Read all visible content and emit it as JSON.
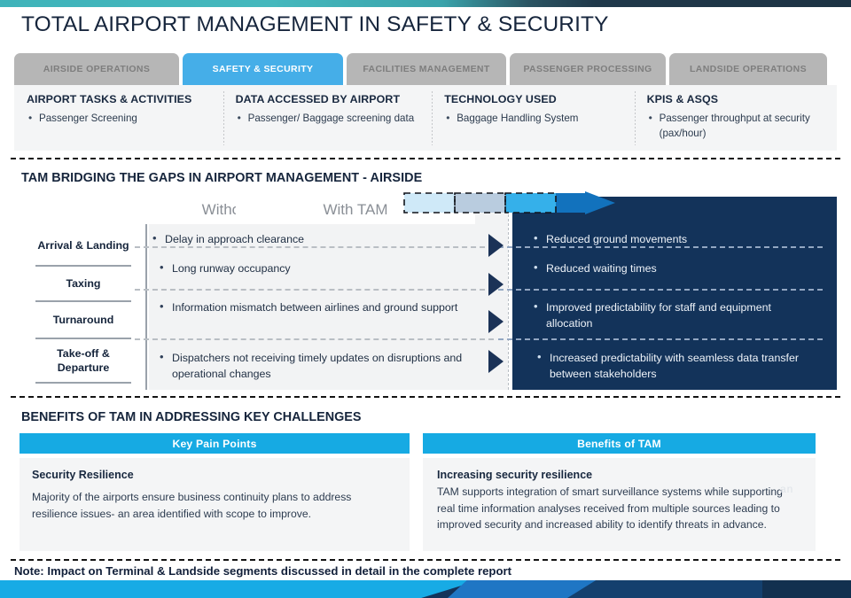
{
  "header": {
    "title": "TOTAL AIRPORT MANAGEMENT IN SAFETY & SECURITY",
    "accent_teal": "#3fb3ba",
    "accent_navy": "#1d3344"
  },
  "tabs": {
    "active_color": "#45aee8",
    "inactive_color": "#b6b6b6",
    "items": [
      {
        "label": "AIRSIDE OPERATIONS",
        "active": false
      },
      {
        "label": "SAFETY & SECURITY",
        "active": true
      },
      {
        "label": "FACILITIES MANAGEMENT",
        "active": false
      },
      {
        "label": "PASSENGER PROCESSING",
        "active": false
      },
      {
        "label": "LANDSIDE OPERATIONS",
        "active": false
      }
    ]
  },
  "info_strip": {
    "columns": [
      {
        "heading": "AIRPORT TASKS & ACTIVITIES",
        "items": [
          "Passenger Screening"
        ]
      },
      {
        "heading": "DATA ACCESSED BY AIRPORT",
        "items": [
          "Passenger/ Baggage screening data"
        ]
      },
      {
        "heading": "TECHNOLOGY USED",
        "items": [
          "Baggage Handling System"
        ]
      },
      {
        "heading": "KPIS & ASQS",
        "items": [
          "Passenger throughput at security (pax/hour)"
        ]
      }
    ]
  },
  "bridging": {
    "heading": "TAM BRIDGING THE GAPS IN AIRPORT MANAGEMENT - AIRSIDE",
    "without_label": "Without TAM",
    "with_label": "With TAM",
    "panel_color": "#13335a",
    "arrow_segments": [
      "#cfe9f8",
      "#b9ccdf",
      "#35b0ea",
      "#1272bd"
    ],
    "stages": [
      "Arrival & Landing",
      "Taxing",
      "Turnaround",
      "Take-off & Departure"
    ],
    "without_items": [
      "Delay in approach clearance",
      "Long runway occupancy",
      "Information mismatch between airlines and ground support",
      "Dispatchers not receiving timely updates on disruptions and operational changes"
    ],
    "with_items": [
      "Reduced ground movements",
      "Reduced waiting times",
      "Improved predictability for staff and equipment allocation",
      "Increased predictability with seamless data transfer between stakeholders"
    ]
  },
  "benefits": {
    "heading": "BENEFITS OF TAM IN ADDRESSING KEY CHALLENGES",
    "header_color": "#16aae3",
    "left_column_header": "Key Pain Points",
    "right_column_header": "Benefits of TAM",
    "left_title": "Security Resilience",
    "left_text": "Majority of the airports  ensure business continuity plans  to address resilience issues- an area identified with  scope to improve.",
    "right_title": "Increasing security resilience",
    "right_text": "TAM supports integration of smart surveillance systems while supporting real time information analyses received from multiple sources leading to improved  security and increased ability to identify threats in advance.",
    "watermark": "an"
  },
  "note": {
    "text": "Note: Impact on Terminal & Landside segments discussed in detail in the complete report"
  },
  "footer": {
    "text": "",
    "colors": [
      "#17abe5",
      "#1f76c4",
      "#14406e",
      "#12304f"
    ]
  }
}
